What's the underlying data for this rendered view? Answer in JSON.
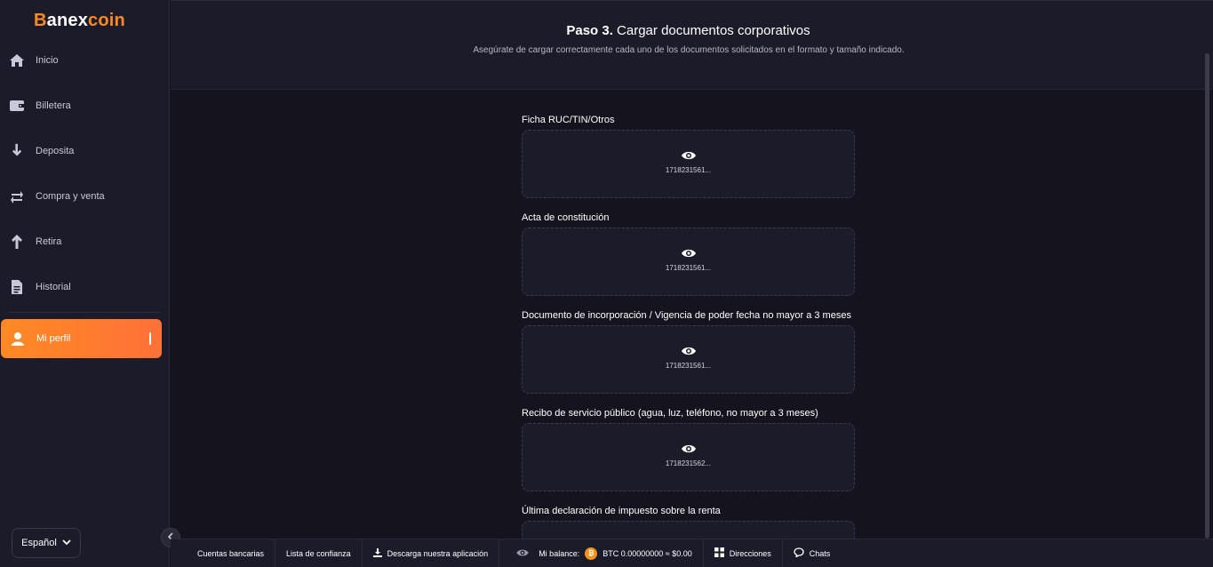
{
  "app": {
    "logo_part1": "B",
    "logo_part2": "anex",
    "logo_part3": "coin",
    "accent_color": "#ff8a24"
  },
  "sidebar": {
    "items": [
      {
        "label": "Inicio",
        "icon": "home-icon"
      },
      {
        "label": "Billetera",
        "icon": "wallet-icon"
      },
      {
        "label": "Deposita",
        "icon": "arrow-down-icon"
      },
      {
        "label": "Compra y venta",
        "icon": "swap-icon"
      },
      {
        "label": "Retira",
        "icon": "arrow-up-icon"
      },
      {
        "label": "Historial",
        "icon": "document-icon"
      },
      {
        "label": "Mi perfil",
        "icon": "user-icon",
        "active": true
      }
    ],
    "language": "Español"
  },
  "header": {
    "step": "Paso 3.",
    "title": "Cargar documentos corporativos",
    "subtitle": "Asegúrate de cargar correctamente cada uno de los documentos solicitados en el formato y tamaño indicado."
  },
  "documents": [
    {
      "label": "Ficha RUC/TIN/Otros",
      "file": "1718231561..."
    },
    {
      "label": "Acta de constitución",
      "file": "1718231561..."
    },
    {
      "label": "Documento de incorporación / Vigencia de poder fecha no mayor a 3 meses",
      "file": "1718231561..."
    },
    {
      "label": "Recibo de servicio público (agua, luz, teléfono, no mayor a 3 meses)",
      "file": "1718231562..."
    },
    {
      "label": "Última declaración de impuesto sobre la renta",
      "file": ""
    }
  ],
  "footer": {
    "bank_accounts": "Cuentas bancarias",
    "trust_list": "Lista de confianza",
    "download_app": "Descarga nuestra aplicación",
    "balance_label": "Mi balance:",
    "balance_value": "BTC 0.00000000 ≈ $0.00",
    "addresses": "Direcciones",
    "chats": "Chats"
  }
}
